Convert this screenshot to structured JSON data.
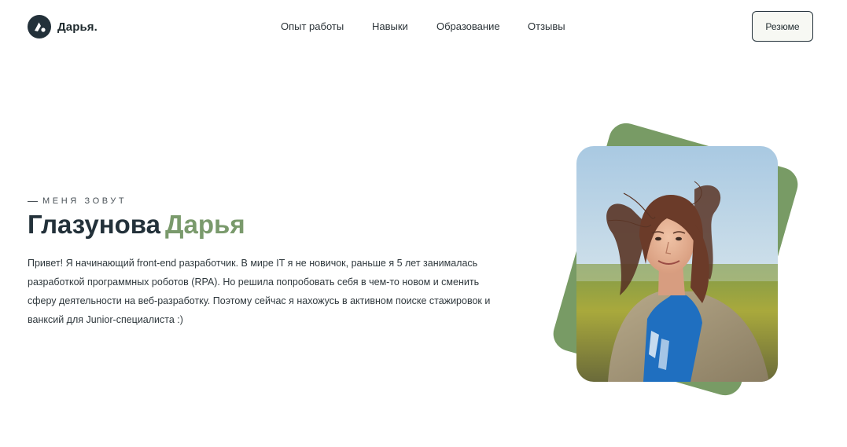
{
  "header": {
    "logo_text": "Дарья.",
    "nav": [
      {
        "label": "Опыт работы"
      },
      {
        "label": "Навыки"
      },
      {
        "label": "Образование"
      },
      {
        "label": "Отзывы"
      }
    ],
    "resume_label": "Резюме"
  },
  "hero": {
    "eyebrow": "МЕНЯ ЗОВУТ",
    "last_name": "Глазунова",
    "first_name": "Дарья",
    "intro": "Привет! Я начинающий front-end разработчик. В мире IT я не новичок, раньше я 5 лет занималась разработкой программных роботов (RPA). Но решила попробовать себя в чем-то новом и сменить сферу деятельности на веб-разработку. Поэтому сейчас я нахожусь в активном поиске стажировок и ванксий для Junior-специалиста :)"
  },
  "colors": {
    "accent_green": "#789b65",
    "dark": "#23313a",
    "button_bg": "#f7f8f3"
  },
  "icons": {
    "logo": "logo-mark-icon",
    "photo": "portrait-photo"
  }
}
